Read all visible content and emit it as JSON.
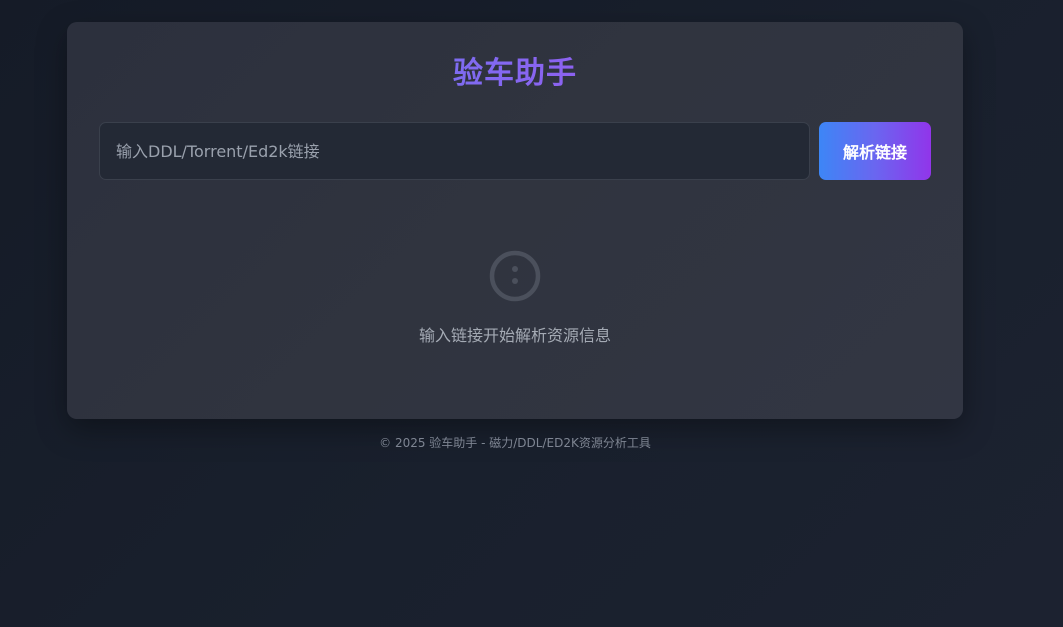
{
  "app": {
    "title": "验车助手"
  },
  "search": {
    "placeholder": "输入DDL/Torrent/Ed2k链接",
    "value": ""
  },
  "actions": {
    "parse_label": "解析链接"
  },
  "empty_state": {
    "icon": "info-circle-icon",
    "message": "输入链接开始解析资源信息"
  },
  "footer": {
    "text": "© 2025 验车助手 - 磁力/DDL/ED2K资源分析工具"
  },
  "colors": {
    "background": "#19202d",
    "card": "#30343f",
    "accent_start": "#3d86f6",
    "accent_end": "#9135ea"
  }
}
